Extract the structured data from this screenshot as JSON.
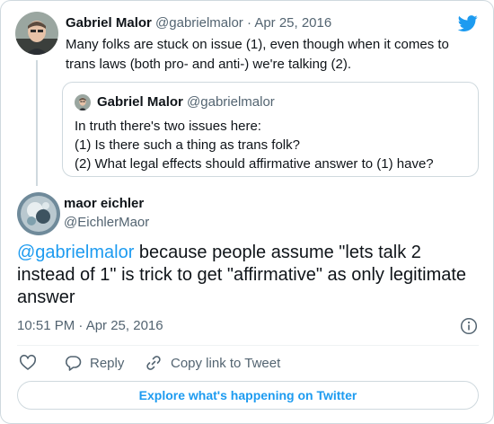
{
  "parent_tweet": {
    "display_name": "Gabriel Malor",
    "handle": "@gabrielmalor",
    "separator": "·",
    "date": "Apr 25, 2016",
    "text": "Many folks are stuck on issue (1), even though when it comes to trans laws (both pro- and anti-) we're talking (2).",
    "quoted_tweet": {
      "display_name": "Gabriel Malor",
      "handle": "@gabrielmalor",
      "lines": [
        "In truth there's two issues here:",
        "(1) Is there such a thing as trans folk?",
        "(2) What legal effects should affirmative answer to (1) have?"
      ]
    }
  },
  "main_tweet": {
    "display_name": "maor eichler",
    "handle": "@EichlerMaor",
    "mention": "@gabrielmalor",
    "text": " because people assume \"lets talk 2 instead of 1\" is trick to get \"affirmative\" as only legitimate answer",
    "timestamp": "10:51 PM · Apr 25, 2016"
  },
  "actions": {
    "reply_label": "Reply",
    "copy_link_label": "Copy link to Tweet"
  },
  "explore_label": "Explore what's happening on Twitter",
  "colors": {
    "accent": "#1d9bf0",
    "text": "#0f1419",
    "muted": "#536471",
    "border": "#cfd9de"
  },
  "icons": {
    "brand": "twitter-bird-icon",
    "info": "info-icon",
    "like": "heart-icon",
    "reply": "speech-bubble-icon",
    "copy": "link-icon"
  }
}
